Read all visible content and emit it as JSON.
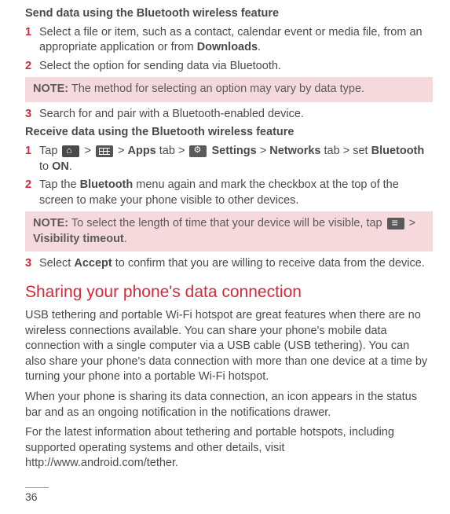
{
  "section1": {
    "heading": "Send data using the Bluetooth wireless feature",
    "steps": [
      {
        "n": "1",
        "parts": [
          "Select a file or item, such as a contact, calendar event or media file, from an appropriate application or from ",
          {
            "b": "Downloads"
          },
          "."
        ]
      },
      {
        "n": "2",
        "parts": [
          "Select the option for sending data via Bluetooth."
        ]
      }
    ],
    "note": {
      "label": "NOTE:",
      "text": " The method for selecting an option may vary by data type."
    },
    "step3": {
      "n": "3",
      "parts": [
        "Search for and pair with a Bluetooth-enabled device."
      ]
    }
  },
  "section2": {
    "heading": "Receive data using the Bluetooth wireless feature",
    "step1": {
      "n": "1",
      "pre": "Tap ",
      "gt": " > ",
      "apps": "Apps",
      "tab": " tab > ",
      "settings": " Settings",
      "networks": "Networks",
      "tabset": " tab > set ",
      "bt": "Bluetooth",
      "to": " to ",
      "on": "ON",
      "dot": "."
    },
    "step2": {
      "n": "2",
      "parts": [
        "Tap the ",
        {
          "b": "Bluetooth"
        },
        " menu again and mark the checkbox at the top of the screen to make your phone visible to other devices."
      ]
    },
    "note": {
      "label": "NOTE:",
      "pre": " To select the length of time that your device will be visible, tap ",
      "gt": " > ",
      "vis": "Visibility timeout",
      "dot": "."
    },
    "step3": {
      "n": "3",
      "parts": [
        "Select ",
        {
          "b": "Accept"
        },
        " to confirm that you are willing to receive data from the device."
      ]
    }
  },
  "share": {
    "title": "Sharing your phone's data connection",
    "p1": "USB tethering and portable Wi-Fi hotspot are great features when there are no wireless connections available. You can share your phone's mobile data connection with a single computer via a USB cable (USB tethering). You can also share your phone's data connection with more than one device at a time by turning your phone into a portable Wi-Fi hotspot.",
    "p2": "When your phone is sharing its data connection, an icon appears in the status bar and as an ongoing notification in the notifications drawer.",
    "p3": "For the latest information about tethering and portable hotspots, including supported operating systems and other details, visit http://www.android.com/tether."
  },
  "pageNumber": "36"
}
